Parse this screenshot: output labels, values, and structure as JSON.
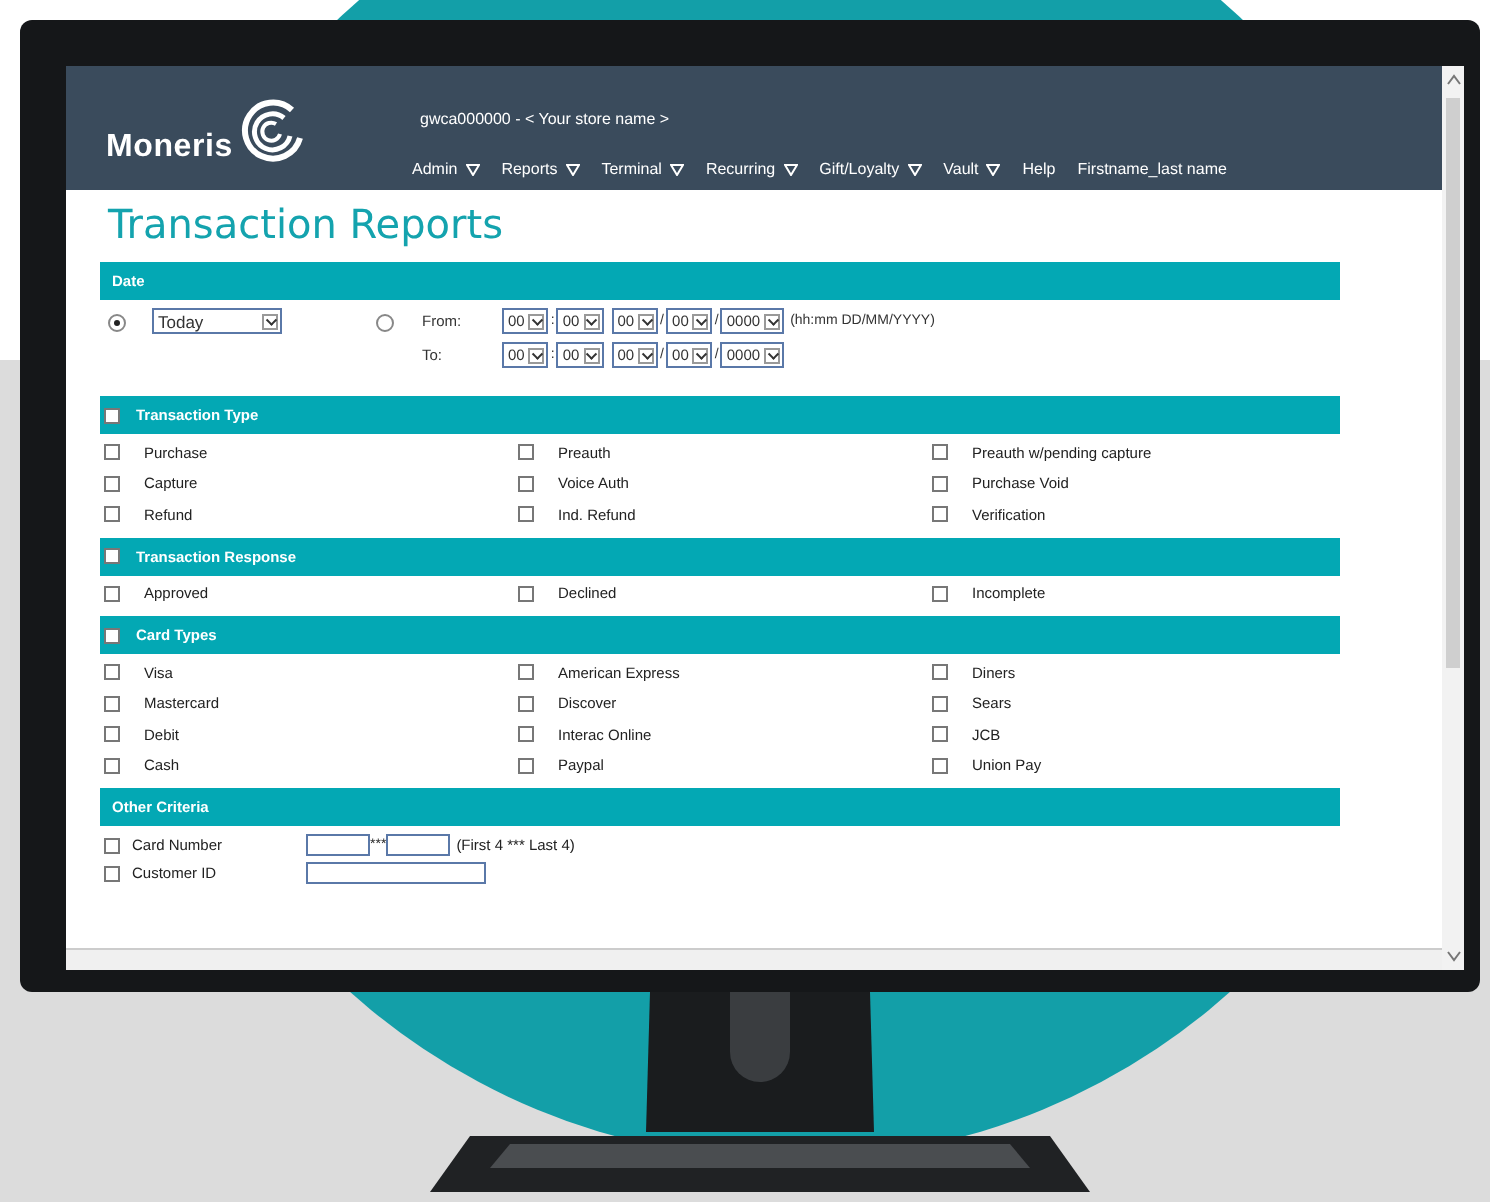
{
  "header": {
    "logo": "Moneris",
    "store": "gwca000000  -  < Your store name >",
    "nav": [
      {
        "label": "Admin",
        "dropdown": true
      },
      {
        "label": "Reports",
        "dropdown": true
      },
      {
        "label": "Terminal",
        "dropdown": true
      },
      {
        "label": "Recurring",
        "dropdown": true
      },
      {
        "label": "Gift/Loyalty",
        "dropdown": true
      },
      {
        "label": "Vault",
        "dropdown": true
      },
      {
        "label": "Help",
        "dropdown": false
      },
      {
        "label": "Firstname_last name",
        "dropdown": false
      }
    ]
  },
  "title": "Transaction Reports",
  "date": {
    "heading": "Date",
    "preset": {
      "selected": true,
      "value": "Today"
    },
    "range": {
      "selected": false,
      "from_label": "From:",
      "to_label": "To:",
      "format": "(hh:mm DD/MM/YYYY)",
      "from": [
        {
          "value": "00"
        },
        {
          "value": "00",
          "sep": ":"
        },
        {
          "value": "00"
        },
        {
          "value": "00",
          "sep": "/"
        },
        {
          "value": "0000",
          "sep": "/"
        }
      ],
      "to": [
        {
          "value": "00"
        },
        {
          "value": "00",
          "sep": ":"
        },
        {
          "value": "00"
        },
        {
          "value": "00",
          "sep": "/"
        },
        {
          "value": "0000",
          "sep": "/"
        }
      ]
    }
  },
  "sections": [
    {
      "heading": "Transaction Type",
      "checked": false,
      "items": [
        {
          "label": "Purchase",
          "checked": false
        },
        {
          "label": "Preauth",
          "checked": false
        },
        {
          "label": "Preauth w/pending capture",
          "checked": false
        },
        {
          "label": "Capture",
          "checked": false
        },
        {
          "label": "Voice Auth",
          "checked": false
        },
        {
          "label": "Purchase Void",
          "checked": false
        },
        {
          "label": "Refund",
          "checked": false
        },
        {
          "label": "Ind. Refund",
          "checked": false
        },
        {
          "label": "Verification",
          "checked": false
        }
      ]
    },
    {
      "heading": "Transaction Response",
      "checked": false,
      "items": [
        {
          "label": "Approved",
          "checked": false
        },
        {
          "label": "Declined",
          "checked": false
        },
        {
          "label": "Incomplete",
          "checked": false
        }
      ]
    },
    {
      "heading": "Card Types",
      "checked": false,
      "items": [
        {
          "label": "Visa",
          "checked": false
        },
        {
          "label": "American Express",
          "checked": false
        },
        {
          "label": "Diners",
          "checked": false
        },
        {
          "label": "Mastercard",
          "checked": false
        },
        {
          "label": "Discover",
          "checked": false
        },
        {
          "label": "Sears",
          "checked": false
        },
        {
          "label": "Debit",
          "checked": false
        },
        {
          "label": "Interac Online",
          "checked": false
        },
        {
          "label": "JCB",
          "checked": false
        },
        {
          "label": "Cash",
          "checked": false
        },
        {
          "label": "Paypal",
          "checked": false
        },
        {
          "label": "Union Pay",
          "checked": false
        }
      ]
    }
  ],
  "other": {
    "heading": "Other Criteria",
    "rows": [
      {
        "kind": "card",
        "label": "Card Number",
        "checked": false,
        "mask": "***",
        "hint": "(First 4 *** Last 4)"
      },
      {
        "kind": "text",
        "label": "Customer ID",
        "checked": false
      }
    ]
  }
}
